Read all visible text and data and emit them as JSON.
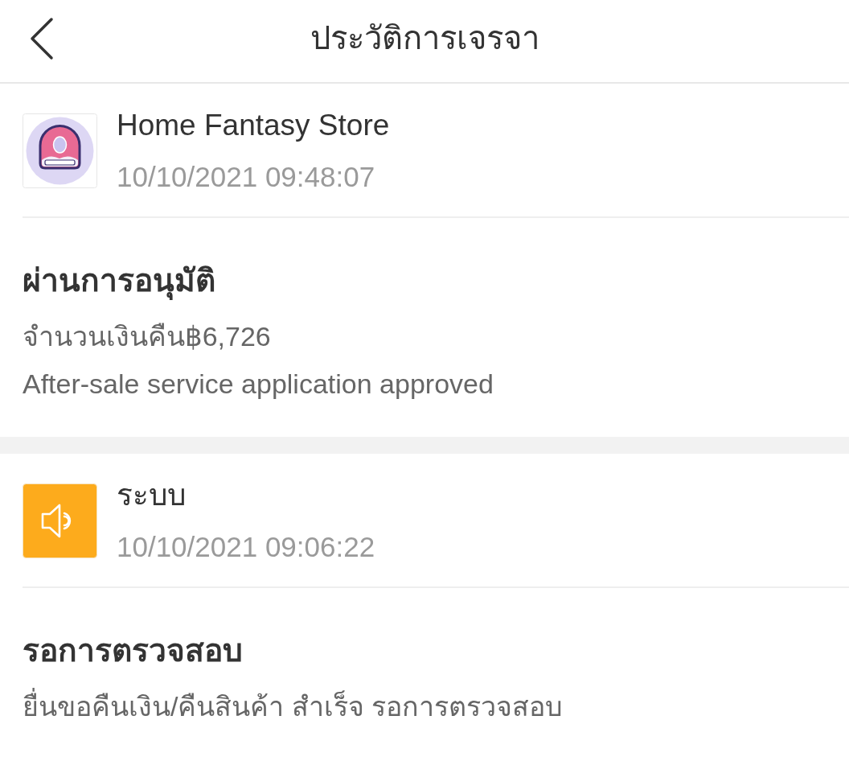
{
  "header": {
    "title": "ประวัติการเจรจา"
  },
  "events": [
    {
      "sender": {
        "kind": "store",
        "name": "Home Fantasy Store",
        "time": "10/10/2021 09:48:07"
      },
      "status": "ผ่านการอนุมัติ",
      "lines": [
        "จำนวนเงินคืน฿6,726",
        "After-sale service application approved"
      ]
    },
    {
      "sender": {
        "kind": "system",
        "name": "ระบบ",
        "time": "10/10/2021 09:06:22"
      },
      "status": "รอการตรวจสอบ",
      "lines": [
        "ยื่นขอคืนเงิน/คืนสินค้า สำเร็จ รอการตรวจสอบ"
      ]
    }
  ]
}
